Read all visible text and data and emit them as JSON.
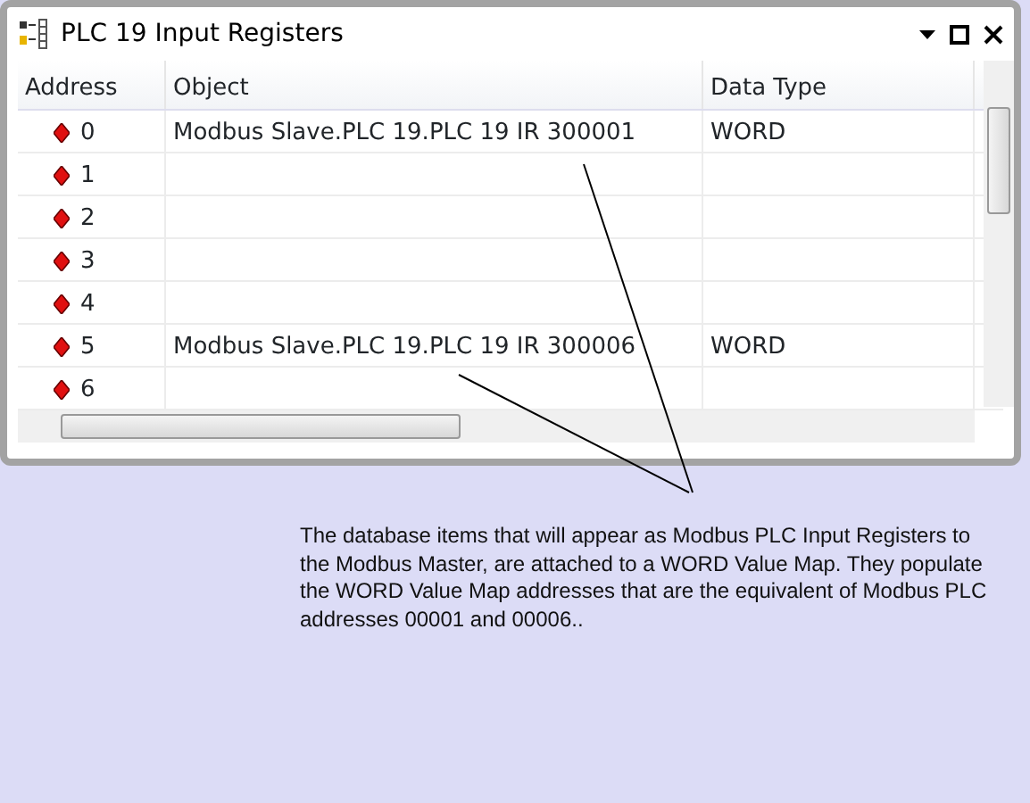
{
  "window": {
    "title": "PLC 19 Input Registers"
  },
  "table": {
    "columns": [
      "Address",
      "Object",
      "Data Type"
    ],
    "rows": [
      {
        "address": "0",
        "object": "Modbus Slave.PLC 19.PLC 19 IR 300001",
        "data_type": "WORD"
      },
      {
        "address": "1"
      },
      {
        "address": "2"
      },
      {
        "address": "3"
      },
      {
        "address": "4"
      },
      {
        "address": "5",
        "object": "Modbus Slave.PLC 19.PLC 19 IR 300006",
        "data_type": "WORD"
      },
      {
        "address": "6"
      }
    ]
  },
  "callout": {
    "text": "The database items that will appear as Modbus PLC Input Registers to the Modbus Master, are attached to a WORD Value Map. They populate the WORD Value Map addresses that are the equivalent of Modbus PLC addresses 00001 and 00006.."
  }
}
